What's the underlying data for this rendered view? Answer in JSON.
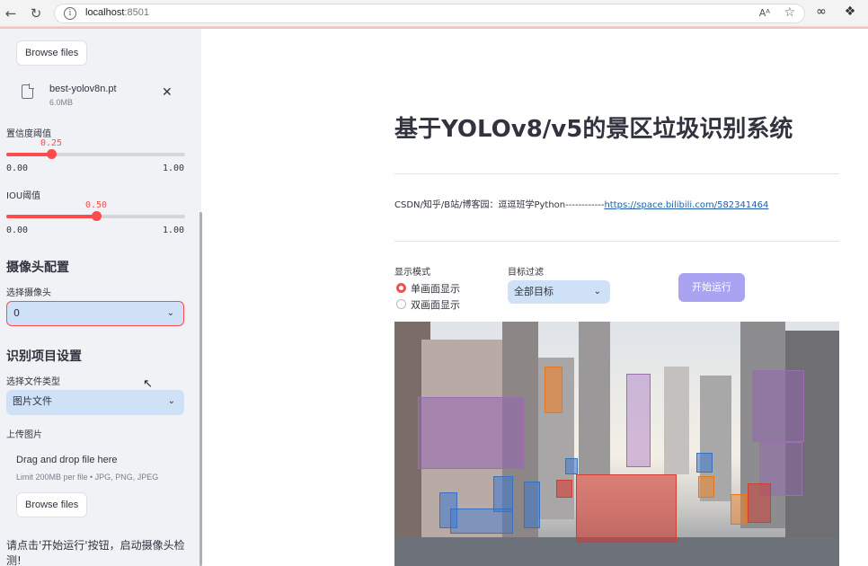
{
  "browser": {
    "url_host": "localhost",
    "url_port": ":8501",
    "reader_label": "Aᴬ"
  },
  "sidebar": {
    "browse_top_label": "Browse files",
    "model_file": {
      "name": "best-yolov8n.pt",
      "size": "6.0MB"
    },
    "conf_slider": {
      "label": "置信度阈值",
      "value": "0.25",
      "fraction": 0.25,
      "min": "0.00",
      "max": "1.00"
    },
    "iou_slider": {
      "label": "IOU阈值",
      "value": "0.50",
      "fraction": 0.5,
      "min": "0.00",
      "max": "1.00"
    },
    "camera_section": {
      "heading": "摄像头配置",
      "select_label": "选择摄像头",
      "selected": "0"
    },
    "project_section": {
      "heading": "识别项目设置",
      "file_type_label": "选择文件类型",
      "file_type_selected": "图片文件"
    },
    "upload": {
      "label": "上传图片",
      "drop_text": "Drag and drop file here",
      "limit_text": "Limit 200MB per file • JPG, PNG, JPEG",
      "browse_label": "Browse files"
    },
    "hint": "请点击'开始运行'按钮，启动摄像头检测!"
  },
  "main": {
    "title": "基于YOLOv8/v5的景区垃圾识别系统",
    "credit_prefix": "CSDN/知乎/B站/博客园：逗逗班学Python------------",
    "credit_link": "https://space.bilibili.com/582341464",
    "display_mode": {
      "label": "显示模式",
      "options": [
        "单画面显示",
        "双画面显示"
      ],
      "selected_index": 0
    },
    "target_filter": {
      "label": "目标过滤",
      "selected": "全部目标"
    },
    "run_button": "开始运行"
  }
}
